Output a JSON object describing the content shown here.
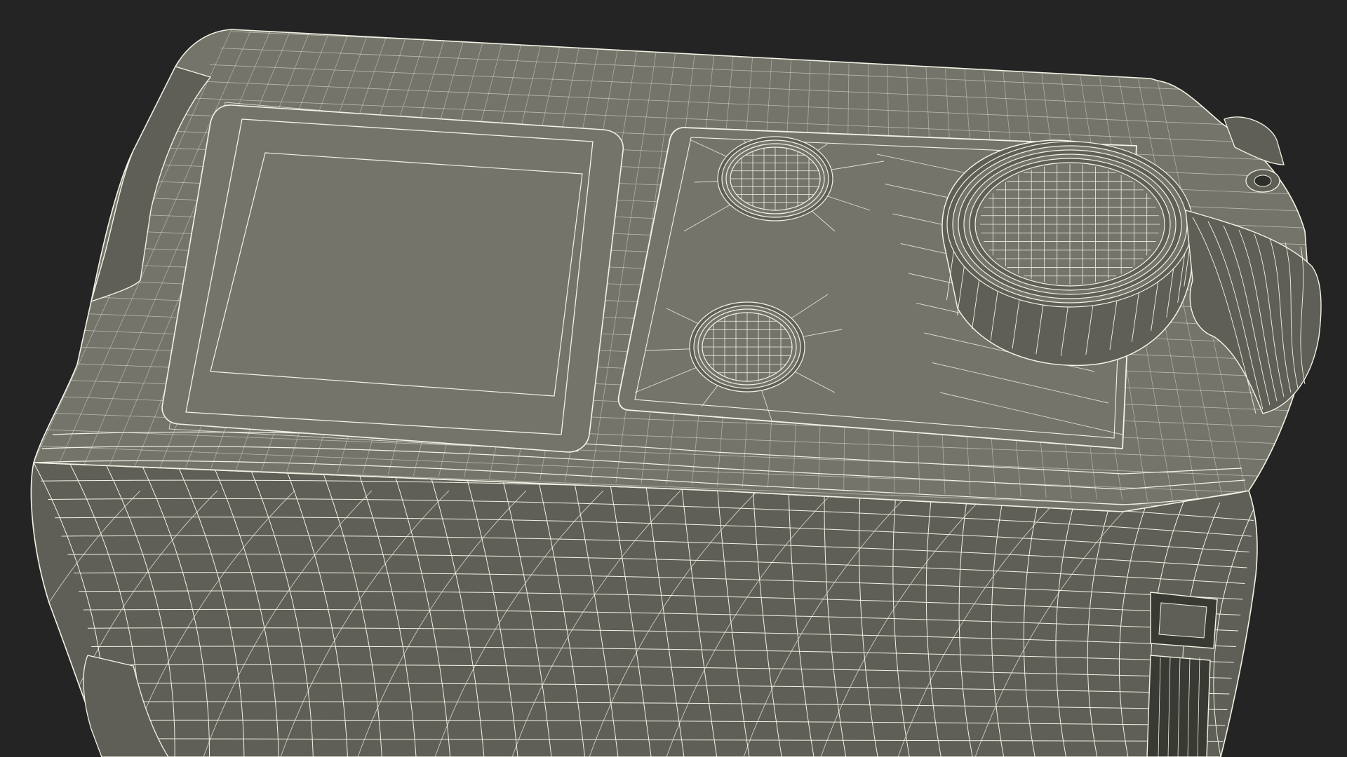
{
  "scene": {
    "background_color": "#242424",
    "surface_color": "#74746a",
    "surface_shadow_color": "#5f5f57",
    "wire_color": "#f2f2e6",
    "subject": "wireframe-render-action-camera"
  }
}
